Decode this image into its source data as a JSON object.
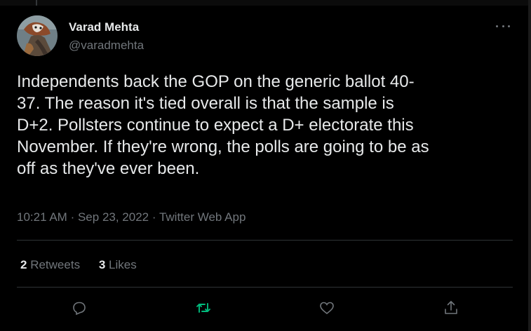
{
  "author": {
    "display_name": "Varad Mehta",
    "handle": "@varadmehta"
  },
  "tweet": {
    "text": "Independents back the GOP on the generic ballot 40-\n37. The reason it's tied overall is that the sample is\nD+2. Pollsters continue to expect a D+ electorate this\nNovember. If they're wrong, the polls are going to be as\noff as they've ever been.",
    "time": "10:21 AM",
    "date": "Sep 23, 2022",
    "source": "Twitter Web App",
    "separator": "·"
  },
  "stats": {
    "retweets_count": "2",
    "retweets_label": "Retweets",
    "likes_count": "3",
    "likes_label": "Likes"
  },
  "icons": {
    "more": "more-icon",
    "reply": "reply-icon",
    "retweet": "retweet-icon",
    "like": "like-icon",
    "share": "share-icon"
  },
  "colors": {
    "background": "#000000",
    "text": "#e7e9ea",
    "muted": "#71767b",
    "divider": "#2f3336",
    "retweet_accent": "#00ba7c"
  }
}
